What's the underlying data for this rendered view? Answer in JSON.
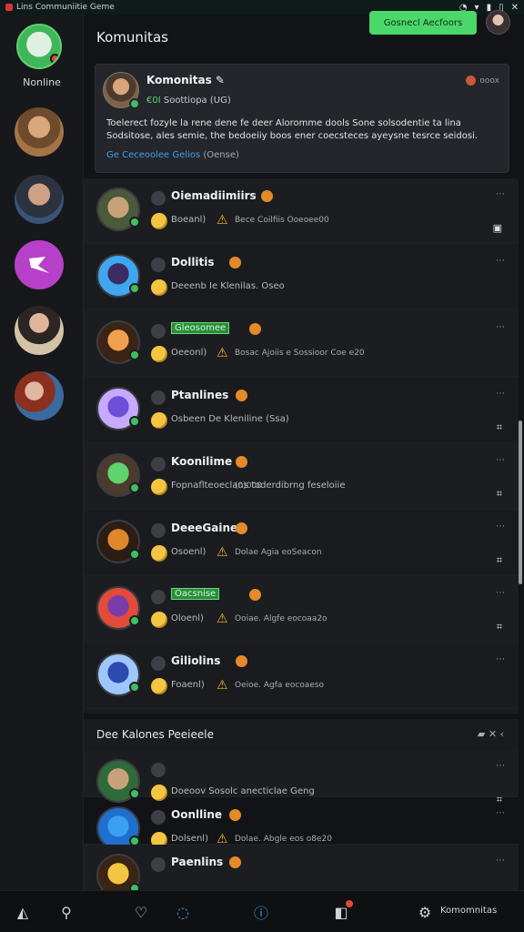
{
  "status_bar": {
    "app_name": "Lins Communiitie Geme",
    "icons": [
      "wifi-icon",
      "wifi-icon",
      "battery-icon",
      "battery-icon",
      "close-icon"
    ]
  },
  "rail": {
    "self_label": "Nonline",
    "items": [
      "avatar",
      "avatar",
      "community-icon",
      "avatar",
      "avatar"
    ]
  },
  "header": {
    "title": "Komunitas",
    "cta_label": "Gosnecl Aecfoors"
  },
  "community": {
    "name": "Komonitas ✎",
    "sub_green": "€0I",
    "sub_rest": "Soottiopa (UG)",
    "flag_text": "ooox",
    "description": "Toelerect fozyle la rene dene fe deer Aloromme dools Sone solsodentie ta lina Sodsitose, ales semie, the bedoeiiy boos ener coecsteces ayeysne tesrce seidosi.",
    "link_text": "Ge Ceceoolee Gelios",
    "link_muted": "(Oense)"
  },
  "rows": [
    {
      "name": "Oiemadiimiirs",
      "meta1": "Boeanl)",
      "meta2": "Bece Coilfiis Ooeoee00",
      "hl": false,
      "warn": true,
      "act": "▣"
    },
    {
      "name": "Dollitis",
      "meta1": "Deeenb Ie Klenilas. Oseo",
      "meta2": "",
      "hl": false,
      "warn": false,
      "act": ""
    },
    {
      "name": "Gleosomee",
      "meta1": "Oeeonl)",
      "meta2": "Bosac Ajoiis e Sossioor Coe e20",
      "hl": true,
      "warn": true,
      "act": ""
    },
    {
      "name": "Ptanlines",
      "meta1": "Osbeen De Kleniline (Ssa)",
      "meta2": "",
      "hl": false,
      "warn": false,
      "act": "⌗"
    },
    {
      "name": "Koonilime",
      "meta1": "Fopnaflteoeclans toderdibrng feseloiie",
      "meta2": "(0)000",
      "hl": false,
      "warn": false,
      "act": "⌗"
    },
    {
      "name": "DeeeGaine",
      "meta1": "Osoenl)",
      "meta2": "Dolae Agia eoSeacon",
      "hl": false,
      "warn": true,
      "act": "⌗"
    },
    {
      "name": "Oacsnise",
      "meta1": "Oloenl)",
      "meta2": "Ooiae. Algfe eocoaa2o",
      "hl": true,
      "warn": true,
      "act": "⌗"
    },
    {
      "name": "Giliolins",
      "meta1": "Foaenl)",
      "meta2": "Oeioe. Agfa eocoaeso",
      "hl": false,
      "warn": true,
      "act": ""
    }
  ],
  "section2": {
    "title": "Dee Kalones Peeieele",
    "tools": "▰ ✕ ‹",
    "rows": [
      {
        "name": "",
        "meta1": "Doeoov Sosolc anecticlae Geng",
        "meta2": "",
        "hl": false,
        "warn": false,
        "act": "⌗"
      },
      {
        "name": "Oonlline",
        "meta1": "Dolsenl)",
        "meta2": "Dolae. Abgle eos o8e20",
        "hl": false,
        "warn": true,
        "act": ""
      },
      {
        "name": "Paenlins",
        "meta1": "",
        "meta2": "",
        "hl": false,
        "warn": false,
        "act": ""
      }
    ]
  },
  "bottom_nav": {
    "icons": [
      "home-icon",
      "search-icon",
      "heart-icon",
      "chat-icon",
      "info-icon",
      "notification-icon",
      "settings-icon"
    ],
    "label": "Komomnitas"
  },
  "colors": {
    "accent_green": "#4bd86b",
    "warn": "#f0b429",
    "badge": "#e24a3a",
    "link": "#3aa0f0"
  }
}
